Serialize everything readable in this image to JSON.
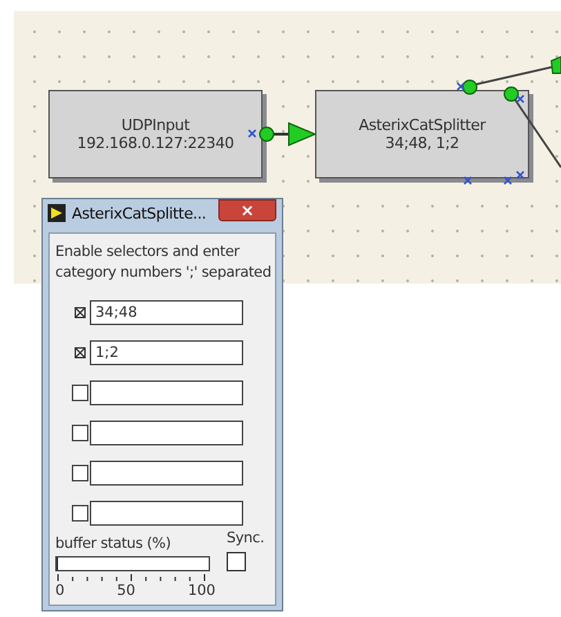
{
  "diagram": {
    "nodes": [
      {
        "title": "UDPInput",
        "subtitle": "192.168.0.127:22340"
      },
      {
        "title": "AsterixCatSplitter",
        "subtitle": "34;48, 1;2"
      }
    ]
  },
  "dialog": {
    "title": "AsterixCatSplitte...",
    "close": "×",
    "instructions": [
      "Enable selectors and enter",
      "category numbers ';' separated"
    ],
    "selectors": [
      {
        "checked": true,
        "value": "34;48"
      },
      {
        "checked": true,
        "value": "1;2"
      },
      {
        "checked": false
      },
      {
        "checked": false
      },
      {
        "checked": false
      },
      {
        "checked": false
      }
    ],
    "buffer": {
      "label": "buffer status (%)",
      "level": 0.01,
      "ticks": [
        "0",
        "50",
        "100"
      ]
    },
    "sync": {
      "label": "Sync.",
      "checked": false
    }
  }
}
